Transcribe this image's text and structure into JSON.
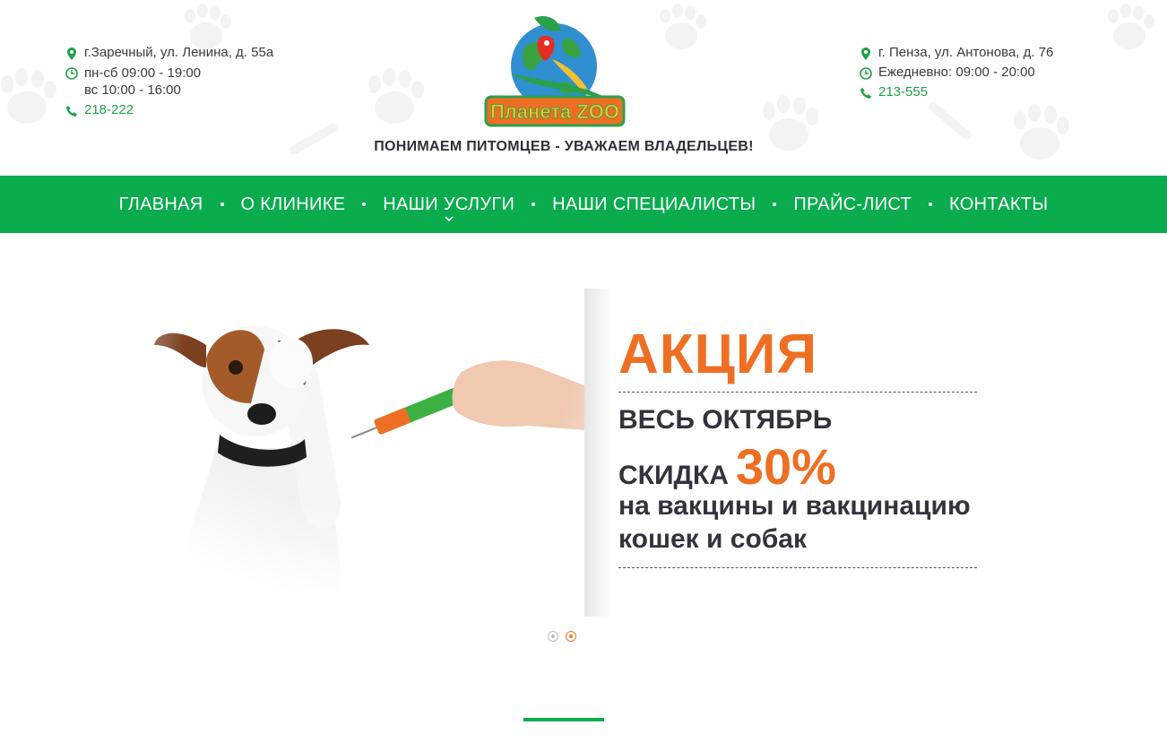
{
  "brand": {
    "logo_text": "Планета ZOO",
    "slogan": "ПОНИМАЕМ ПИТОМЦЕВ - УВАЖАЕМ ВЛАДЕЛЬЦЕВ!"
  },
  "contacts_left": {
    "address": "г.Заречный, ул. Ленина, д. 55а",
    "hours_line1": "пн-сб 09:00 - 19:00",
    "hours_line2": "вс 10:00 - 16:00",
    "phone": "218-222"
  },
  "contacts_right": {
    "address": "г. Пенза, ул. Антонова, д. 76",
    "hours": "Ежедневно: 09:00 - 20:00",
    "phone": "213-555"
  },
  "nav": {
    "items": [
      {
        "label": "ГЛАВНАЯ"
      },
      {
        "label": "О КЛИНИКЕ"
      },
      {
        "label": "НАШИ УСЛУГИ",
        "has_dropdown": true
      },
      {
        "label": "НАШИ СПЕЦИАЛИСТЫ"
      },
      {
        "label": "ПРАЙС-ЛИСТ"
      },
      {
        "label": "КОНТАКТЫ"
      }
    ]
  },
  "promo": {
    "title": "АКЦИЯ",
    "line1": "ВЕСЬ ОКТЯБРЬ",
    "line2_prefix": "СКИДКА",
    "line2_percent": "30%",
    "line3": "на вакцины и вакцинацию",
    "line4": "кошек и собак"
  },
  "slider": {
    "total": 2,
    "active": 2
  },
  "colors": {
    "green": "#0aac4e",
    "orange": "#ee6f23",
    "text_dark": "#33333d"
  },
  "icons": {
    "address": "map-pin-icon",
    "hours": "clock-icon",
    "phone": "phone-icon"
  }
}
